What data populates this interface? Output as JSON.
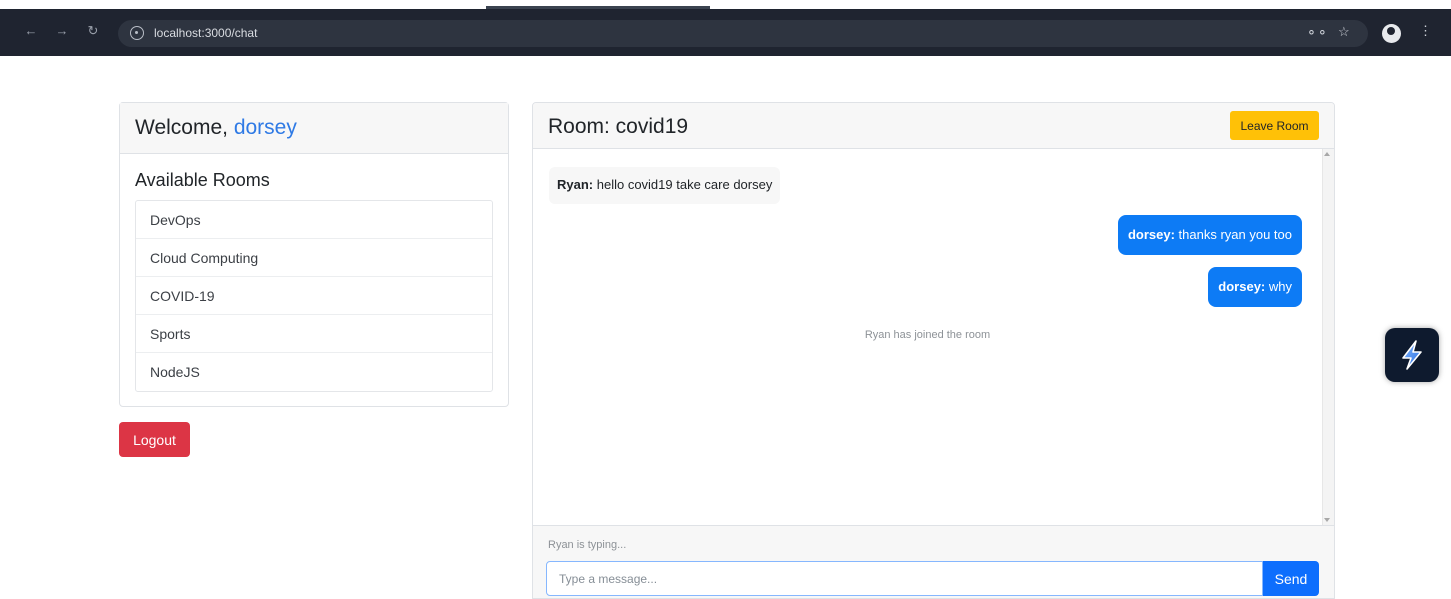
{
  "browser": {
    "url": "localhost:3000/chat",
    "back_icon": "arrow-left-icon",
    "forward_icon": "arrow-right-icon",
    "reload_icon": "reload-icon",
    "site_info_icon": "site-info-icon",
    "password_key_icon": "key-icon",
    "bookmark_icon": "star-icon",
    "profile_icon": "profile-icon",
    "menu_icon": "kebab-menu-icon"
  },
  "sidebar": {
    "welcome_prefix": "Welcome, ",
    "username": "dorsey",
    "rooms_title": "Available Rooms",
    "rooms": [
      "DevOps",
      "Cloud Computing",
      "COVID-19",
      "Sports",
      "NodeJS"
    ],
    "logout_label": "Logout"
  },
  "chat": {
    "room_title": "Room: covid19",
    "leave_label": "Leave Room",
    "messages": [
      {
        "sender": "Ryan:",
        "text": " hello covid19 take care dorsey",
        "direction": "incoming"
      },
      {
        "sender": "dorsey:",
        "text": " thanks ryan you too",
        "direction": "outgoing"
      },
      {
        "sender": "dorsey:",
        "text": " why",
        "direction": "outgoing"
      }
    ],
    "system_message": "Ryan has joined the room",
    "typing_indicator": "Ryan is typing...",
    "input_placeholder": "Type a message...",
    "send_label": "Send"
  },
  "colors": {
    "browser_bar": "#1f2430",
    "username_link": "#2f7ae5",
    "logout": "#dc3545",
    "leave_room": "#ffc107",
    "outgoing_bubble": "#0d7bf5",
    "send": "#0d6efd"
  },
  "extension": {
    "icon": "lightning-bolt-icon"
  }
}
